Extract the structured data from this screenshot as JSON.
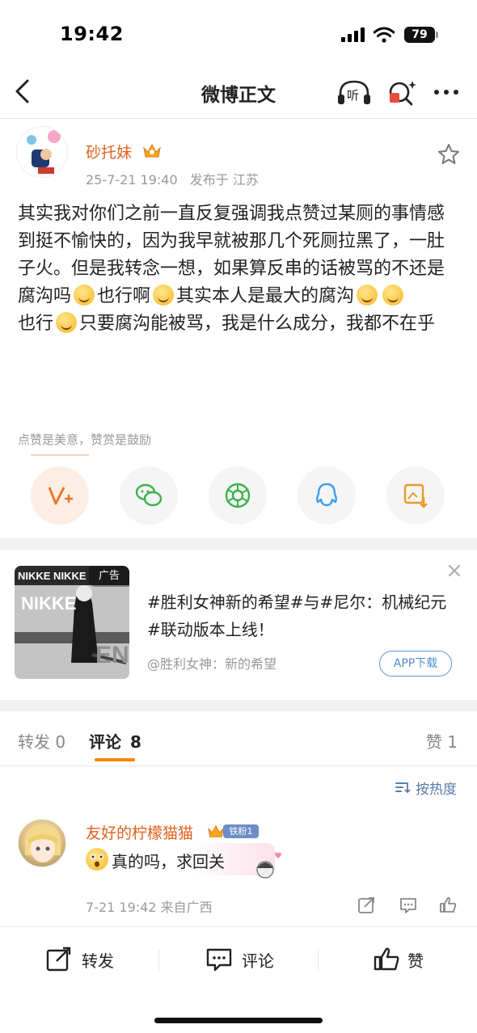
{
  "status": {
    "time": "19:42",
    "battery": "79"
  },
  "nav": {
    "title": "微博正文",
    "listen_label": "听"
  },
  "post": {
    "username": "砂托妹",
    "date": "25-7-21 19:40",
    "published_at": "发布于 江苏",
    "text": {
      "l1": "其实我对你们之前一直反复强调我点赞过某厕的事情感到挺不愉快的，因为我早就被那几个死厕拉黑了，一肚子火。但是我转念一想，如果算反串的话被骂的不还是腐沟吗",
      "l2": "也行啊",
      "l3": "其实本人是最大的腐沟",
      "l4": "也行",
      "l5": "只要腐沟能被骂，我是什么成分，我都不在乎"
    },
    "reward_hint": "点赞是美意，赞赏是鼓励"
  },
  "ad": {
    "tag": "广告",
    "title": "#胜利女神新的希望#与#尼尔：机械纪元#联动版本上线！",
    "source": "@胜利女神：新的希望",
    "button": "APP下载",
    "image_text": "NIKKE"
  },
  "tabs": {
    "repost": "转发 0",
    "comments_label": "评论",
    "comments_count": "8",
    "likes": "赞 1"
  },
  "sort_label": "按热度",
  "comment": {
    "username": "友好的柠檬猫猫",
    "fan_badge": "铁粉1",
    "text": "真的吗，求回关",
    "meta": "7-21 19:42  来自广西"
  },
  "bottom": {
    "repost": "转发",
    "comment": "评论",
    "like": "赞"
  },
  "colors": {
    "accent": "#ff8200",
    "username": "#e0611c",
    "link": "#5a7ea8"
  }
}
